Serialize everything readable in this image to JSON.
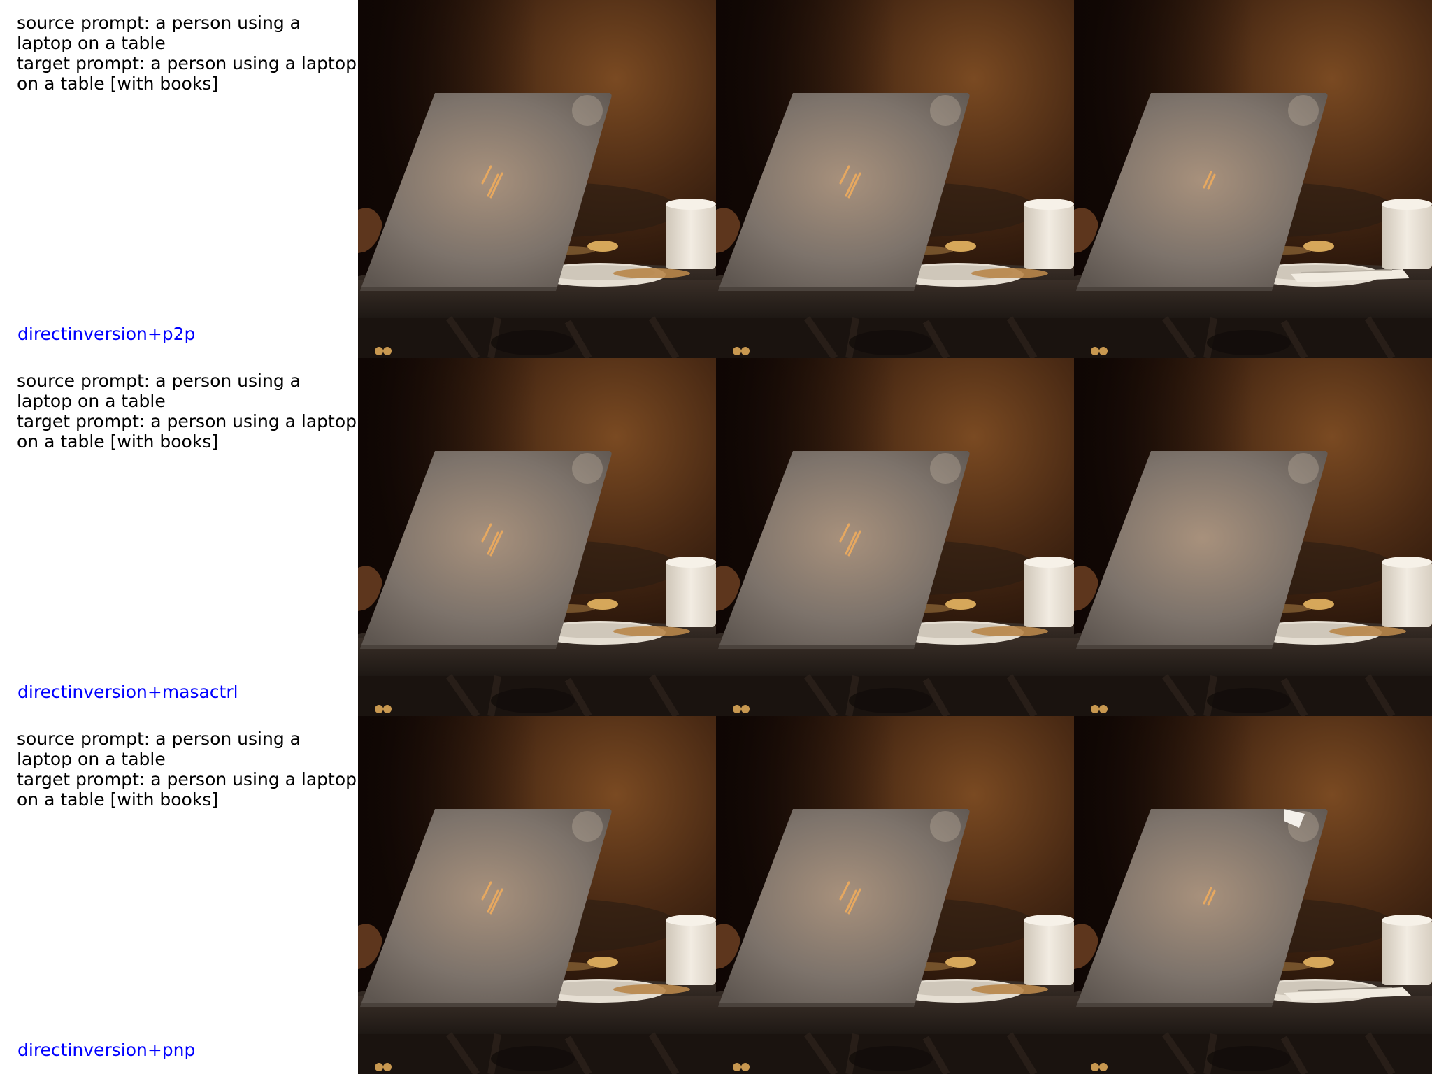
{
  "rows": [
    {
      "source_prompt": "source prompt: a person using a laptop on a table",
      "target_prompt": "target prompt: a person using a laptop on a table [with books]",
      "method": "directinversion+p2p",
      "method_color": "#0000ff",
      "edited_variant": "papers-on-plate"
    },
    {
      "source_prompt": "source prompt: a person using a laptop on a table",
      "target_prompt": "target prompt: a person using a laptop on a table [with books]",
      "method": "directinversion+masactrl",
      "method_color": "#0000ff",
      "edited_variant": "no-logo"
    },
    {
      "source_prompt": "source prompt: a person using a laptop on a table",
      "target_prompt": "target prompt: a person using a laptop on a table [with books]",
      "method": "directinversion+pnp",
      "method_color": "#0000ff",
      "edited_variant": "papers-and-corner-sheet"
    }
  ],
  "image_columns": [
    "source-image",
    "reconstruction-image",
    "edited-image"
  ],
  "scene": {
    "background_dark": "#1a0c06",
    "warm_glow": "#7a4a22",
    "laptop_lid": "#8a7f76",
    "logo_color": "#e6a860",
    "table_top": "#2a221e",
    "cup": "#e8e2d8",
    "plate": "#d9d2c6"
  }
}
